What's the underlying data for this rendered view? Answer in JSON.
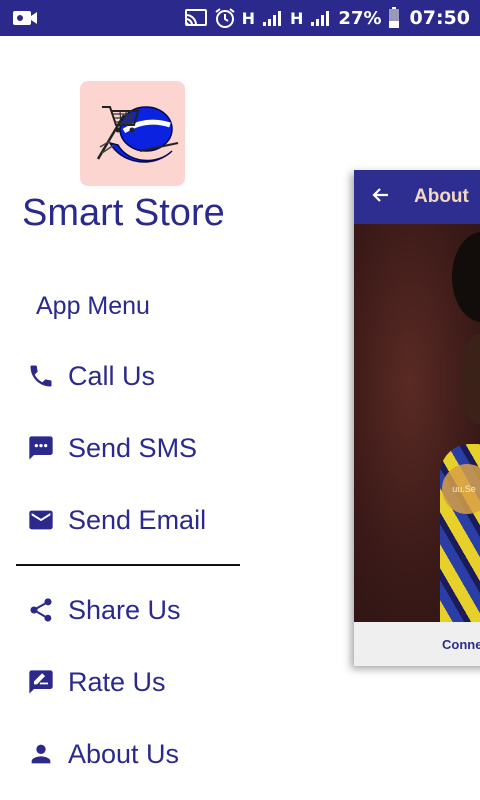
{
  "status_bar": {
    "network_1": "H",
    "network_2": "H",
    "battery_percent": "27%",
    "time": "07:50",
    "icons": [
      "video-camera-icon",
      "cast-icon",
      "alarm-icon",
      "signal-icon",
      "battery-icon"
    ]
  },
  "drawer": {
    "app_title": "Smart Store",
    "menu_header": "App Menu",
    "items_primary": [
      {
        "label": "Call Us",
        "icon": "phone-icon"
      },
      {
        "label": "Send SMS",
        "icon": "sms-icon"
      },
      {
        "label": "Send Email",
        "icon": "email-icon"
      }
    ],
    "items_secondary": [
      {
        "label": "Share Us",
        "icon": "share-icon"
      },
      {
        "label": "Rate Us",
        "icon": "rate-icon"
      },
      {
        "label": "About Us",
        "icon": "person-icon"
      }
    ]
  },
  "background_app": {
    "title": "About",
    "fab_text": "uu.Se",
    "footer_text": "Conne"
  },
  "colors": {
    "primary": "#2b2a8c",
    "status_bar": "#2b2a8c",
    "logo_background": "#fcd4d0",
    "divider": "#111111"
  }
}
